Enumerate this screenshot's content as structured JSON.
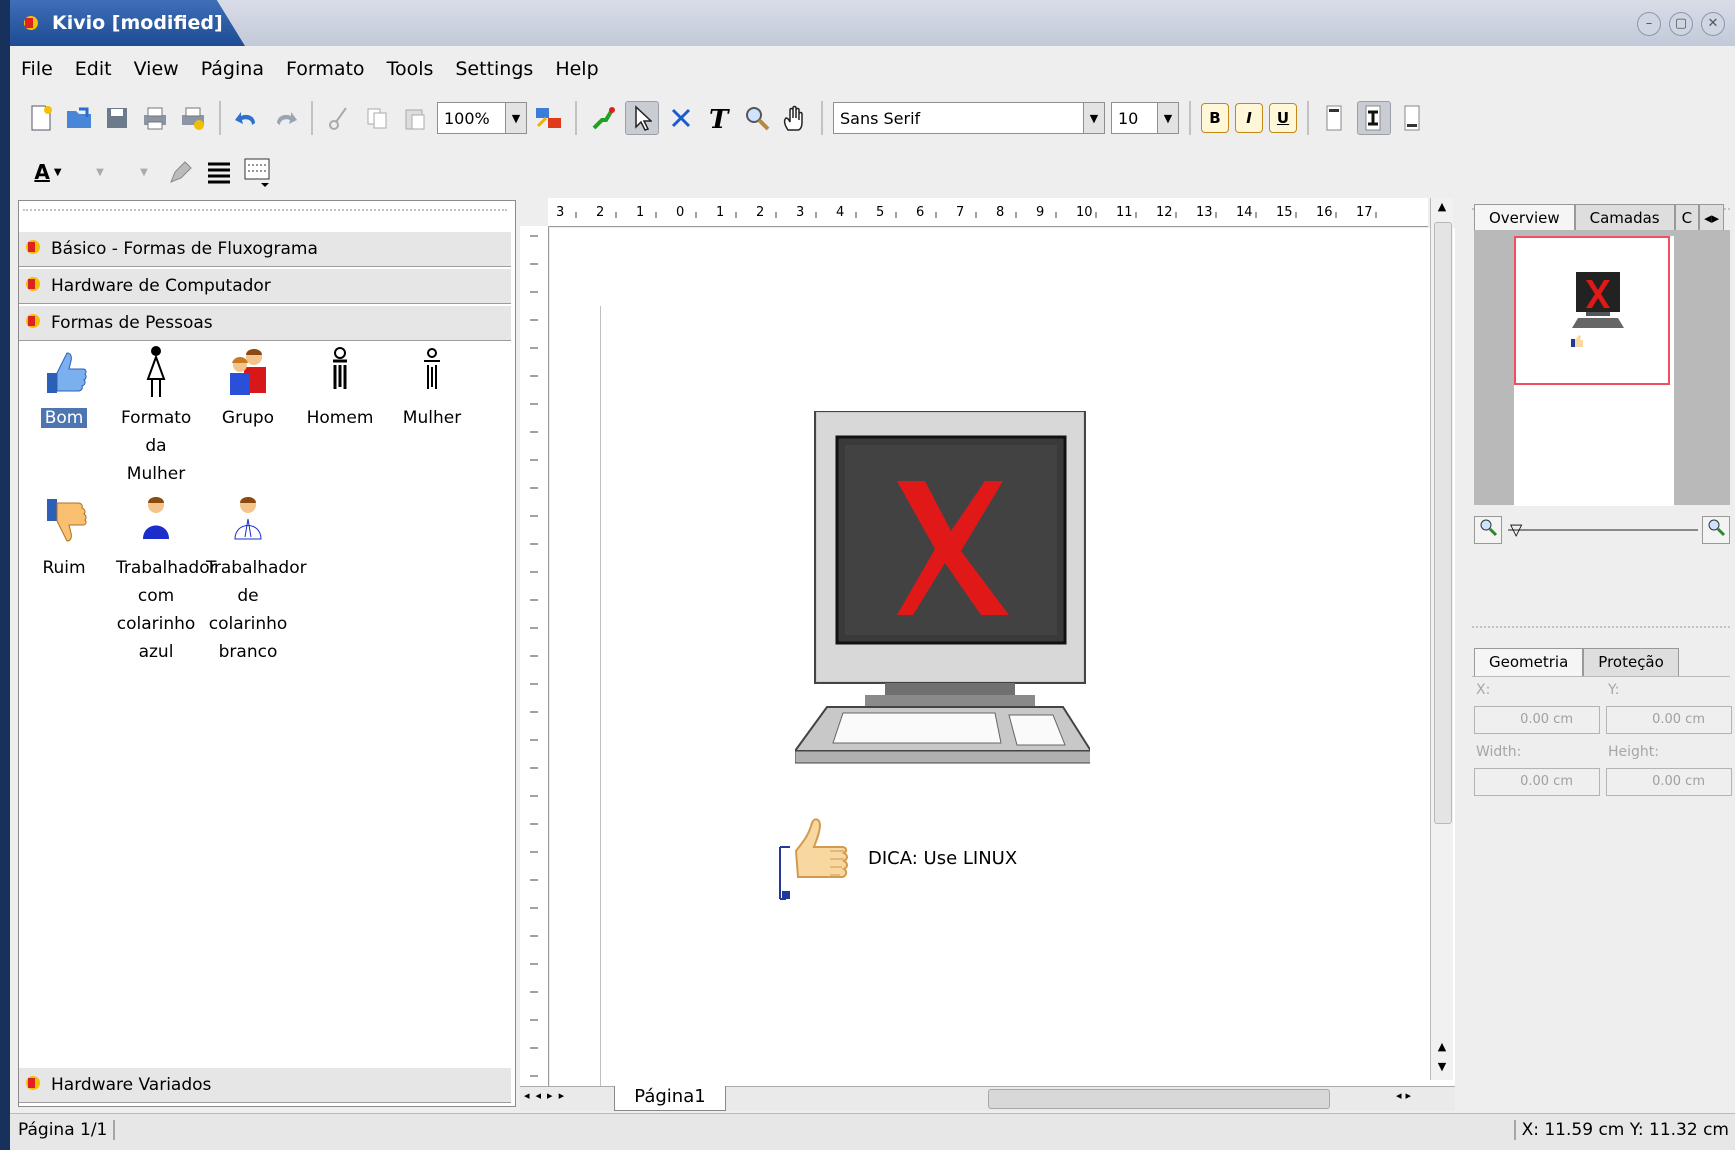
{
  "window": {
    "title": "Kivio [modified]"
  },
  "menubar": [
    "File",
    "Edit",
    "View",
    "Página",
    "Formato",
    "Tools",
    "Settings",
    "Help"
  ],
  "toolbar": {
    "zoom": "100%",
    "font_family": "Sans Serif",
    "font_size": "10",
    "bold": "B",
    "italic": "I",
    "underline": "U",
    "text_color": "A"
  },
  "stencils": {
    "groups": [
      "Básico - Formas de Fluxograma",
      "Hardware de Computador",
      "Formas de Pessoas",
      "Hardware Variados"
    ],
    "shapes": [
      {
        "label": "Bom",
        "icon": "thumbs-up-icon"
      },
      {
        "label": "Formato da Mulher",
        "icon": "woman-outline-icon"
      },
      {
        "label": "Grupo",
        "icon": "group-icon"
      },
      {
        "label": "Homem",
        "icon": "man-symbol-icon"
      },
      {
        "label": "Mulher",
        "icon": "woman-symbol-icon"
      },
      {
        "label": "Ruim",
        "icon": "thumbs-down-icon"
      },
      {
        "label": "Trabalhador com colarinho azul",
        "icon": "blue-collar-worker-icon"
      },
      {
        "label": "Trabalhador de colarinho branco",
        "icon": "white-collar-worker-icon"
      }
    ]
  },
  "canvas": {
    "ruler_marks": [
      "3",
      "2",
      "1",
      "0",
      "1",
      "2",
      "3",
      "4",
      "5",
      "6",
      "7",
      "8",
      "9",
      "10",
      "11",
      "12",
      "13",
      "14",
      "15",
      "16",
      "17"
    ],
    "callout_text": "DICA: Use LINUX",
    "page_tab": "Página1"
  },
  "right_panel": {
    "tabs_top": [
      "Overview",
      "Camadas",
      "C"
    ],
    "tabs_bottom": [
      "Geometria",
      "Proteção"
    ],
    "fields": {
      "x_label": "X:",
      "y_label": "Y:",
      "width_label": "Width:",
      "height_label": "Height:",
      "x_value": "0.00 cm",
      "y_value": "0.00 cm",
      "width_value": "0.00 cm",
      "height_value": "0.00 cm"
    }
  },
  "status": {
    "page": "Página 1/1",
    "coords": "X: 11.59 cm Y: 11.32 cm"
  },
  "colors": {
    "title_tab": "#2c5aa0",
    "selection": "#4d76b0",
    "overview_frame": "#f04f5f",
    "monitor_x": "#e01818"
  }
}
